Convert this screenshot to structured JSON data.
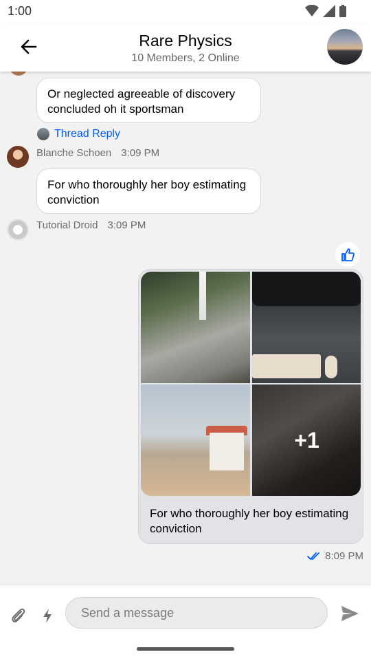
{
  "status_bar": {
    "time": "1:00"
  },
  "header": {
    "title": "Rare Physics",
    "subtitle": "10 Members, 2 Online"
  },
  "messages": [
    {
      "text": "Or neglected agreeable of discovery concluded oh it sportsman",
      "thread_reply_label": "Thread Reply"
    },
    {
      "author": "Blanche Schoen",
      "time": "3:09 PM",
      "text": "For who thoroughly her boy estimating conviction"
    },
    {
      "author": "Tutorial Droid",
      "time": "3:09 PM"
    }
  ],
  "own_message": {
    "reaction_icon": "thumbs-up-icon",
    "more_images_label": "+1",
    "caption": "For who thoroughly her boy estimating conviction",
    "time": "8:09 PM",
    "status_icon": "double-check-icon"
  },
  "composer": {
    "placeholder": "Send a message",
    "value": ""
  },
  "colors": {
    "accent": "#005fff",
    "background": "#f2f2f2",
    "own_bubble": "#e2e3e7"
  }
}
